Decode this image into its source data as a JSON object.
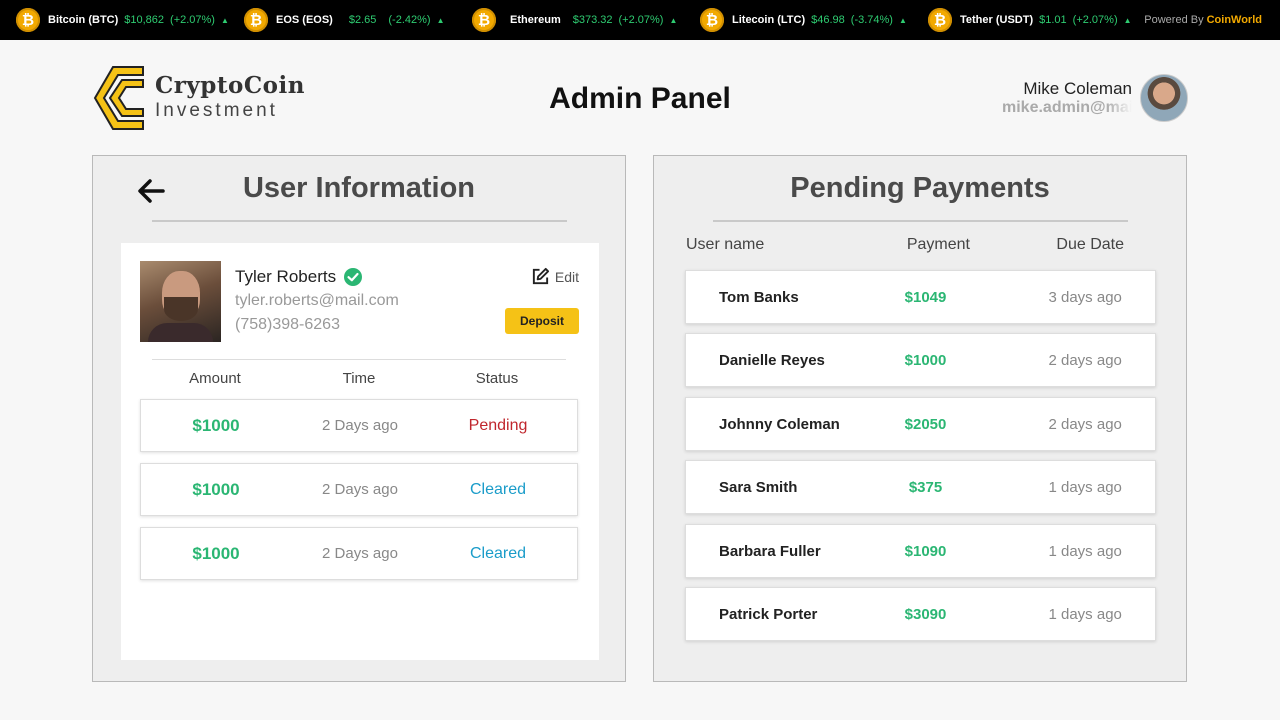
{
  "ticker": {
    "items": [
      {
        "name": "Bitcoin (BTC)",
        "price": "$10,862",
        "change": "(+2.07%)"
      },
      {
        "name": "EOS (EOS)",
        "price": "$2.65",
        "change": "(-2.42%)"
      },
      {
        "name": "Ethereum",
        "price": "$373.32",
        "change": "(+2.07%)"
      },
      {
        "name": "Litecoin (LTC)",
        "price": "$46.98",
        "change": "(-3.74%)"
      },
      {
        "name": "Tether (USDT)",
        "price": "$1.01",
        "change": "(+2.07%)"
      }
    ],
    "coin_symbol": "₿",
    "arrow": "▲",
    "powered_by": "Powered By",
    "powered_brand": "CoinWorld"
  },
  "logo": {
    "title": "CryptoCoin",
    "subtitle": "Investment"
  },
  "page_title": "Admin Panel",
  "admin": {
    "name": "Mike Coleman",
    "email": "mike.admin@mail.com"
  },
  "user_info": {
    "title": "User Information",
    "name": "Tyler Roberts",
    "email": "tyler.roberts@mail.com",
    "phone": "(758)398-6263",
    "edit_label": "Edit",
    "deposit_label": "Deposit",
    "columns": [
      "Amount",
      "Time",
      "Status"
    ],
    "transactions": [
      {
        "amount": "$1000",
        "time": "2 Days ago",
        "status": "Pending"
      },
      {
        "amount": "$1000",
        "time": "2 Days ago",
        "status": "Cleared"
      },
      {
        "amount": "$1000",
        "time": "2 Days ago",
        "status": "Cleared"
      }
    ]
  },
  "pending": {
    "title": "Pending Payments",
    "columns": [
      "User name",
      "Payment",
      "Due Date"
    ],
    "rows": [
      {
        "user": "Tom Banks",
        "payment": "$1049",
        "due": "3 days ago"
      },
      {
        "user": "Danielle Reyes",
        "payment": "$1000",
        "due": "2 days ago"
      },
      {
        "user": "Johnny Coleman",
        "payment": "$2050",
        "due": "2 days ago"
      },
      {
        "user": "Sara Smith",
        "payment": "$375",
        "due": "1 days ago"
      },
      {
        "user": "Barbara Fuller",
        "payment": "$1090",
        "due": "1 days ago"
      },
      {
        "user": "Patrick Porter",
        "payment": "$3090",
        "due": "1 days ago"
      }
    ]
  },
  "colors": {
    "accent": "#f5c216",
    "positive": "#2bb673",
    "pending": "#c0262d",
    "cleared": "#1a9cc9"
  }
}
